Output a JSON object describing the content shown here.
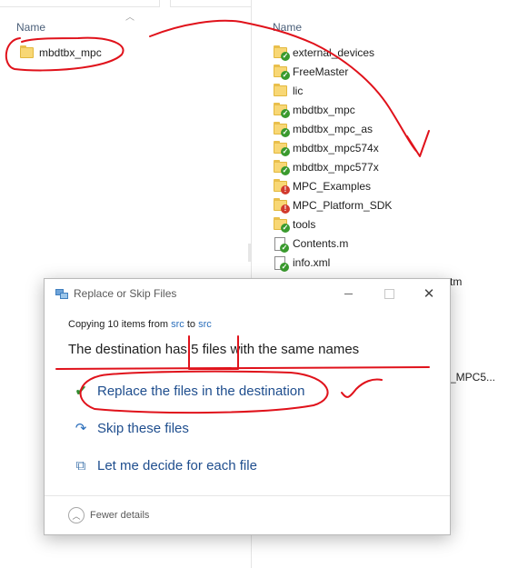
{
  "left_pane": {
    "header_name": "Name",
    "items": [
      {
        "name": "mbdtbx_mpc",
        "icon": "folder-icon"
      }
    ]
  },
  "right_pane": {
    "header_name": "Name",
    "items": [
      {
        "name": "external_devices",
        "icon": "folder-sync-ok-icon"
      },
      {
        "name": "FreeMaster",
        "icon": "folder-sync-ok-icon"
      },
      {
        "name": "lic",
        "icon": "folder-icon"
      },
      {
        "name": "mbdtbx_mpc",
        "icon": "folder-sync-ok-icon"
      },
      {
        "name": "mbdtbx_mpc_as",
        "icon": "folder-sync-ok-icon"
      },
      {
        "name": "mbdtbx_mpc574x",
        "icon": "folder-sync-ok-icon"
      },
      {
        "name": "mbdtbx_mpc577x",
        "icon": "folder-sync-ok-icon"
      },
      {
        "name": "MPC_Examples",
        "icon": "folder-sync-error-icon"
      },
      {
        "name": "MPC_Platform_SDK",
        "icon": "folder-sync-error-icon"
      },
      {
        "name": "tools",
        "icon": "folder-sync-ok-icon"
      },
      {
        "name": "Contents.m",
        "icon": "file-sync-ok-icon"
      },
      {
        "name": "info.xml",
        "icon": "file-sync-ok-icon"
      }
    ],
    "partial_texts": [
      "tm",
      "_MPC5..."
    ]
  },
  "dialog": {
    "title": "Replace or Skip Files",
    "copying_prefix": "Copying 10 items from ",
    "source": "src",
    "copying_mid": " to ",
    "destination": "src",
    "dest_prefix": "The destination has ",
    "dest_count": "5 files",
    "dest_suffix": " with the same names",
    "options": {
      "replace": "Replace the files in the destination",
      "skip": "Skip these files",
      "decide": "Let me decide for each file"
    },
    "fewer_details": "Fewer details",
    "close_glyph": "✕"
  },
  "colors": {
    "link": "#2a6ebb",
    "option_text": "#1f4e8e",
    "annotation": "#e0121b",
    "check": "#2f8c2f"
  }
}
